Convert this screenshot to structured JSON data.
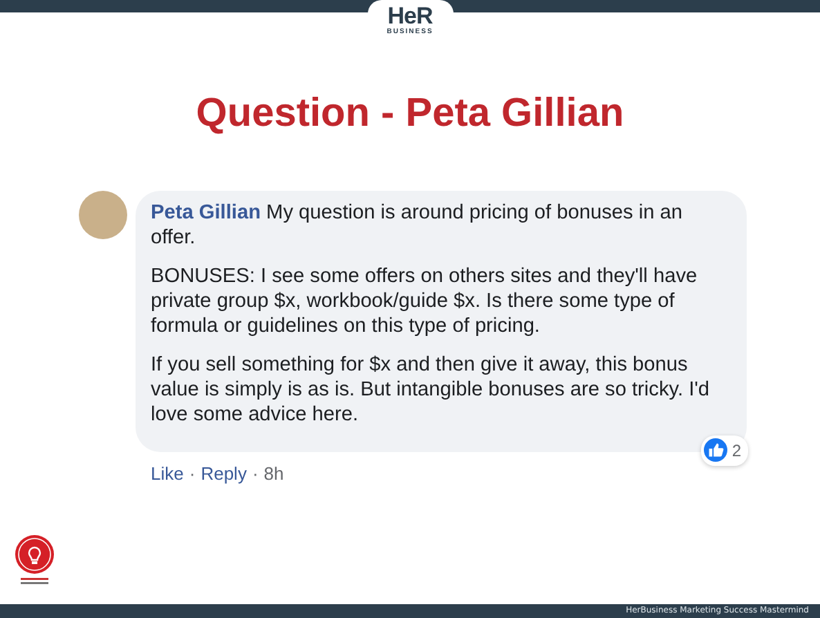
{
  "header": {
    "logo_top": "HeR",
    "logo_bottom": "BUSINESS"
  },
  "title": "Question - Peta Gillian",
  "comment": {
    "author": "Peta Gillian",
    "paragraphs": [
      "My question is around pricing of bonuses in an offer.",
      "BONUSES: I see some offers on others sites and they'll have private group $x, workbook/guide $x. Is there some type of formula or guidelines on this type of pricing.",
      "If you sell something for $x and then give it away, this bonus value is simply is as is. But intangible bonuses are so tricky. I'd love some advice here."
    ],
    "actions": [
      {
        "kind": "link",
        "text": "Like"
      },
      {
        "kind": "dot",
        "text": "·"
      },
      {
        "kind": "link",
        "text": "Reply"
      },
      {
        "kind": "dot",
        "text": "·"
      },
      {
        "kind": "time",
        "text": "8h"
      }
    ],
    "reaction_count": "2"
  },
  "footer": "HerBusiness Marketing Success Mastermind"
}
